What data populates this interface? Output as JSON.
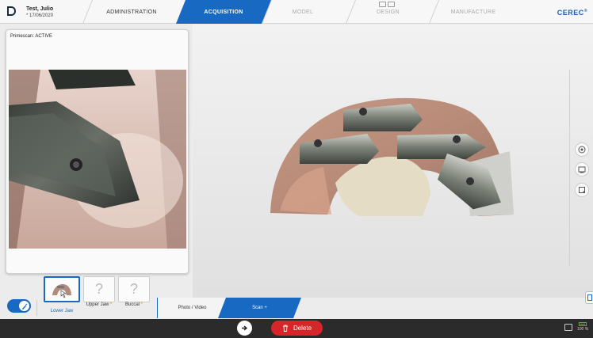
{
  "patient": {
    "name": "Test, Julio",
    "dob": "* 17/06/2020"
  },
  "steps": [
    {
      "label": "ADMINISTRATION",
      "state": "done"
    },
    {
      "label": "ACQUISITION",
      "state": "active"
    },
    {
      "label": "MODEL",
      "state": "future"
    },
    {
      "label": "DESIGN",
      "state": "future"
    },
    {
      "label": "MANUFACTURE",
      "state": "future"
    }
  ],
  "brand": "CEREC",
  "brand_mark": "®",
  "camera": {
    "status": "Primescan: ACTIVE"
  },
  "scans": [
    {
      "label": "Lower Jaw",
      "star": "",
      "placeholder": "",
      "selected": true
    },
    {
      "label": "Upper Jaw",
      "star": "*",
      "placeholder": "?",
      "selected": false
    },
    {
      "label": "Buccal",
      "star": "*",
      "placeholder": "?",
      "selected": false
    }
  ],
  "phases": {
    "photo_video": "Photo / Video",
    "scan": "Scan +"
  },
  "actions": {
    "delete": "Delete"
  },
  "battery": {
    "percent": "100 %"
  },
  "colors": {
    "accent": "#1769c2",
    "delete": "#d7262a",
    "bottombar": "#2b2b2b"
  },
  "icons": {
    "logo": "dentsply-logo-icon",
    "toggle": "brush-icon",
    "forward": "arrow-right-icon",
    "delete": "trash-icon",
    "tools": [
      "tooth-icon",
      "model-icon",
      "note-icon"
    ]
  }
}
